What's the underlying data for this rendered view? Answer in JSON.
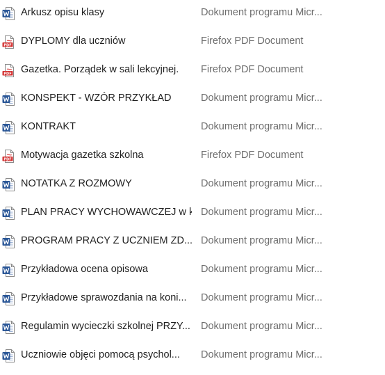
{
  "files": [
    {
      "name": "Arkusz opisu klasy",
      "type": "Dokument programu Micr...",
      "icon": "word-document-icon"
    },
    {
      "name": "DYPLOMY dla uczniów",
      "type": "Firefox PDF Document",
      "icon": "pdf-document-icon"
    },
    {
      "name": "Gazetka. Porządek w sali lekcyjnej.",
      "type": "Firefox PDF Document",
      "icon": "pdf-document-icon"
    },
    {
      "name": "KONSPEKT - WZÓR PRZYKŁAD",
      "type": "Dokument programu Micr...",
      "icon": "word-document-icon"
    },
    {
      "name": "KONTRAKT",
      "type": "Dokument programu Micr...",
      "icon": "word-document-icon"
    },
    {
      "name": "Motywacja gazetka szkolna",
      "type": "Firefox PDF Document",
      "icon": "pdf-document-icon"
    },
    {
      "name": "NOTATKA Z ROZMOWY",
      "type": "Dokument programu Micr...",
      "icon": "word-document-icon"
    },
    {
      "name": "PLAN PRACY WYCHOWAWCZEJ w k...",
      "type": "Dokument programu Micr...",
      "icon": "word-document-icon"
    },
    {
      "name": "PROGRAM PRACY Z UCZNIEM ZD...",
      "type": "Dokument programu Micr...",
      "icon": "word-document-icon"
    },
    {
      "name": "Przykładowa ocena opisowa",
      "type": "Dokument programu Micr...",
      "icon": "word-document-icon"
    },
    {
      "name": "Przykładowe sprawozdania na koni...",
      "type": "Dokument programu Micr...",
      "icon": "word-document-icon"
    },
    {
      "name": "Regulamin wycieczki szkolnej PRZY...",
      "type": "Dokument programu Micr...",
      "icon": "word-document-icon"
    },
    {
      "name": "Uczniowie objęci pomocą psychol...",
      "type": "Dokument programu Micr...",
      "icon": "word-document-icon"
    }
  ],
  "colors": {
    "name_text": "#1f1f1f",
    "type_text": "#6d6d6d",
    "word_blue": "#2b5797",
    "pdf_red": "#d32f2f"
  }
}
